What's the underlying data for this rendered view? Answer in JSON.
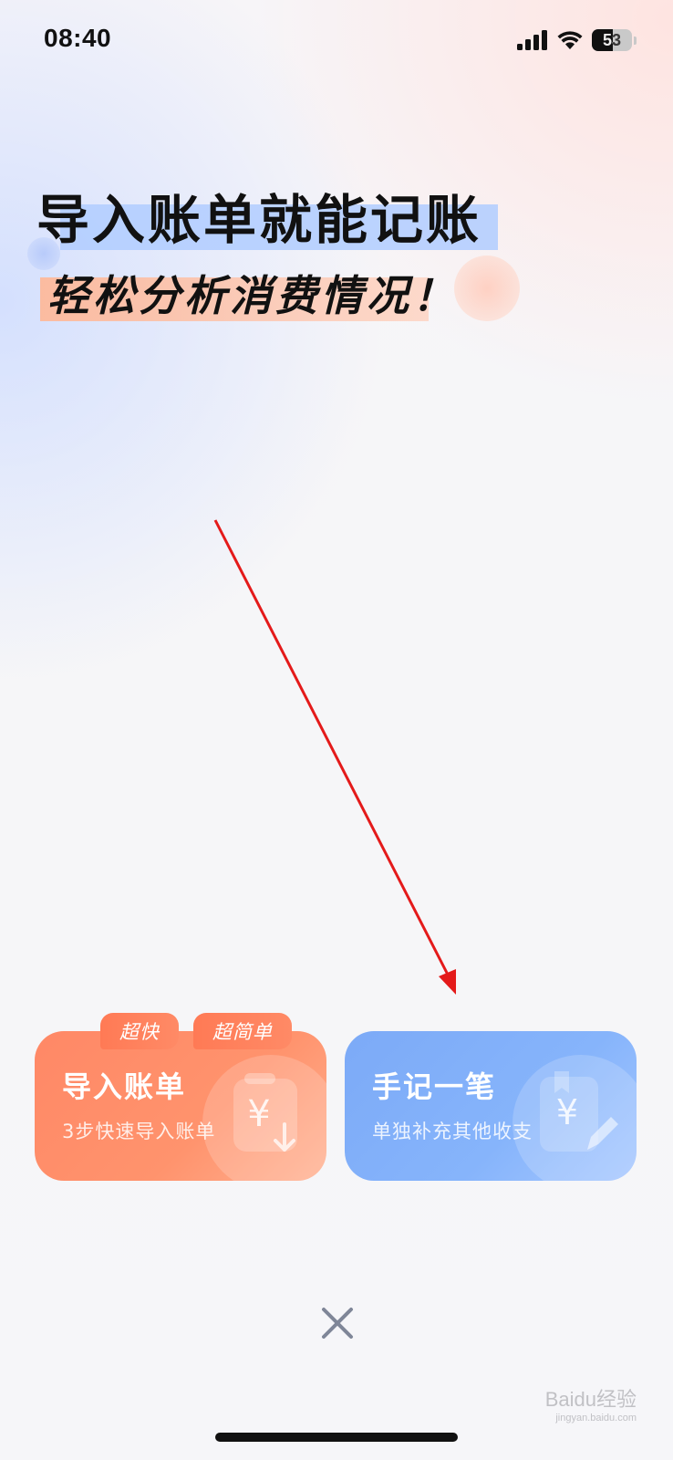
{
  "status_bar": {
    "time": "08:40",
    "battery_level": "53"
  },
  "hero": {
    "line1": "导入账单就能记账",
    "line2": "轻松分析消费情况！"
  },
  "cards": {
    "import": {
      "title": "导入账单",
      "subtitle": "3步快速导入账单",
      "badges": [
        "超快",
        "超简单"
      ],
      "color": "#ff8a66"
    },
    "manual": {
      "title": "手记一笔",
      "subtitle": "单独补充其他收支",
      "color": "#86b4fb"
    }
  },
  "icons": {
    "close": "close-icon",
    "arrow": "red-arrow-annotation"
  },
  "watermark": {
    "text": "Baidu经验",
    "sub": "jingyan.baidu.com"
  },
  "colors": {
    "annotation_arrow": "#e41a1a"
  }
}
